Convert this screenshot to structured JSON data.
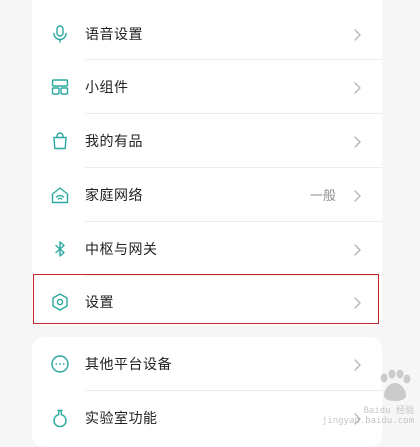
{
  "menu_main": {
    "items": [
      {
        "label": "语音设置",
        "icon": "microphone-icon"
      },
      {
        "label": "小组件",
        "icon": "widgets-icon"
      },
      {
        "label": "我的有品",
        "icon": "shopping-bag-icon"
      },
      {
        "label": "家庭网络",
        "icon": "home-wifi-icon",
        "value": "一般"
      },
      {
        "label": "中枢与网关",
        "icon": "bluetooth-icon"
      },
      {
        "label": "设置",
        "icon": "settings-hexagon-icon"
      }
    ]
  },
  "menu_secondary": {
    "items": [
      {
        "label": "其他平台设备",
        "icon": "more-dots-icon"
      },
      {
        "label": "实验室功能",
        "icon": "flask-icon"
      }
    ]
  },
  "watermark": {
    "brand": "Baidu 经验",
    "url": "jingyan.baidu.com"
  },
  "colors": {
    "accent": "#2ba99f",
    "highlight_border": "#c8262b"
  }
}
